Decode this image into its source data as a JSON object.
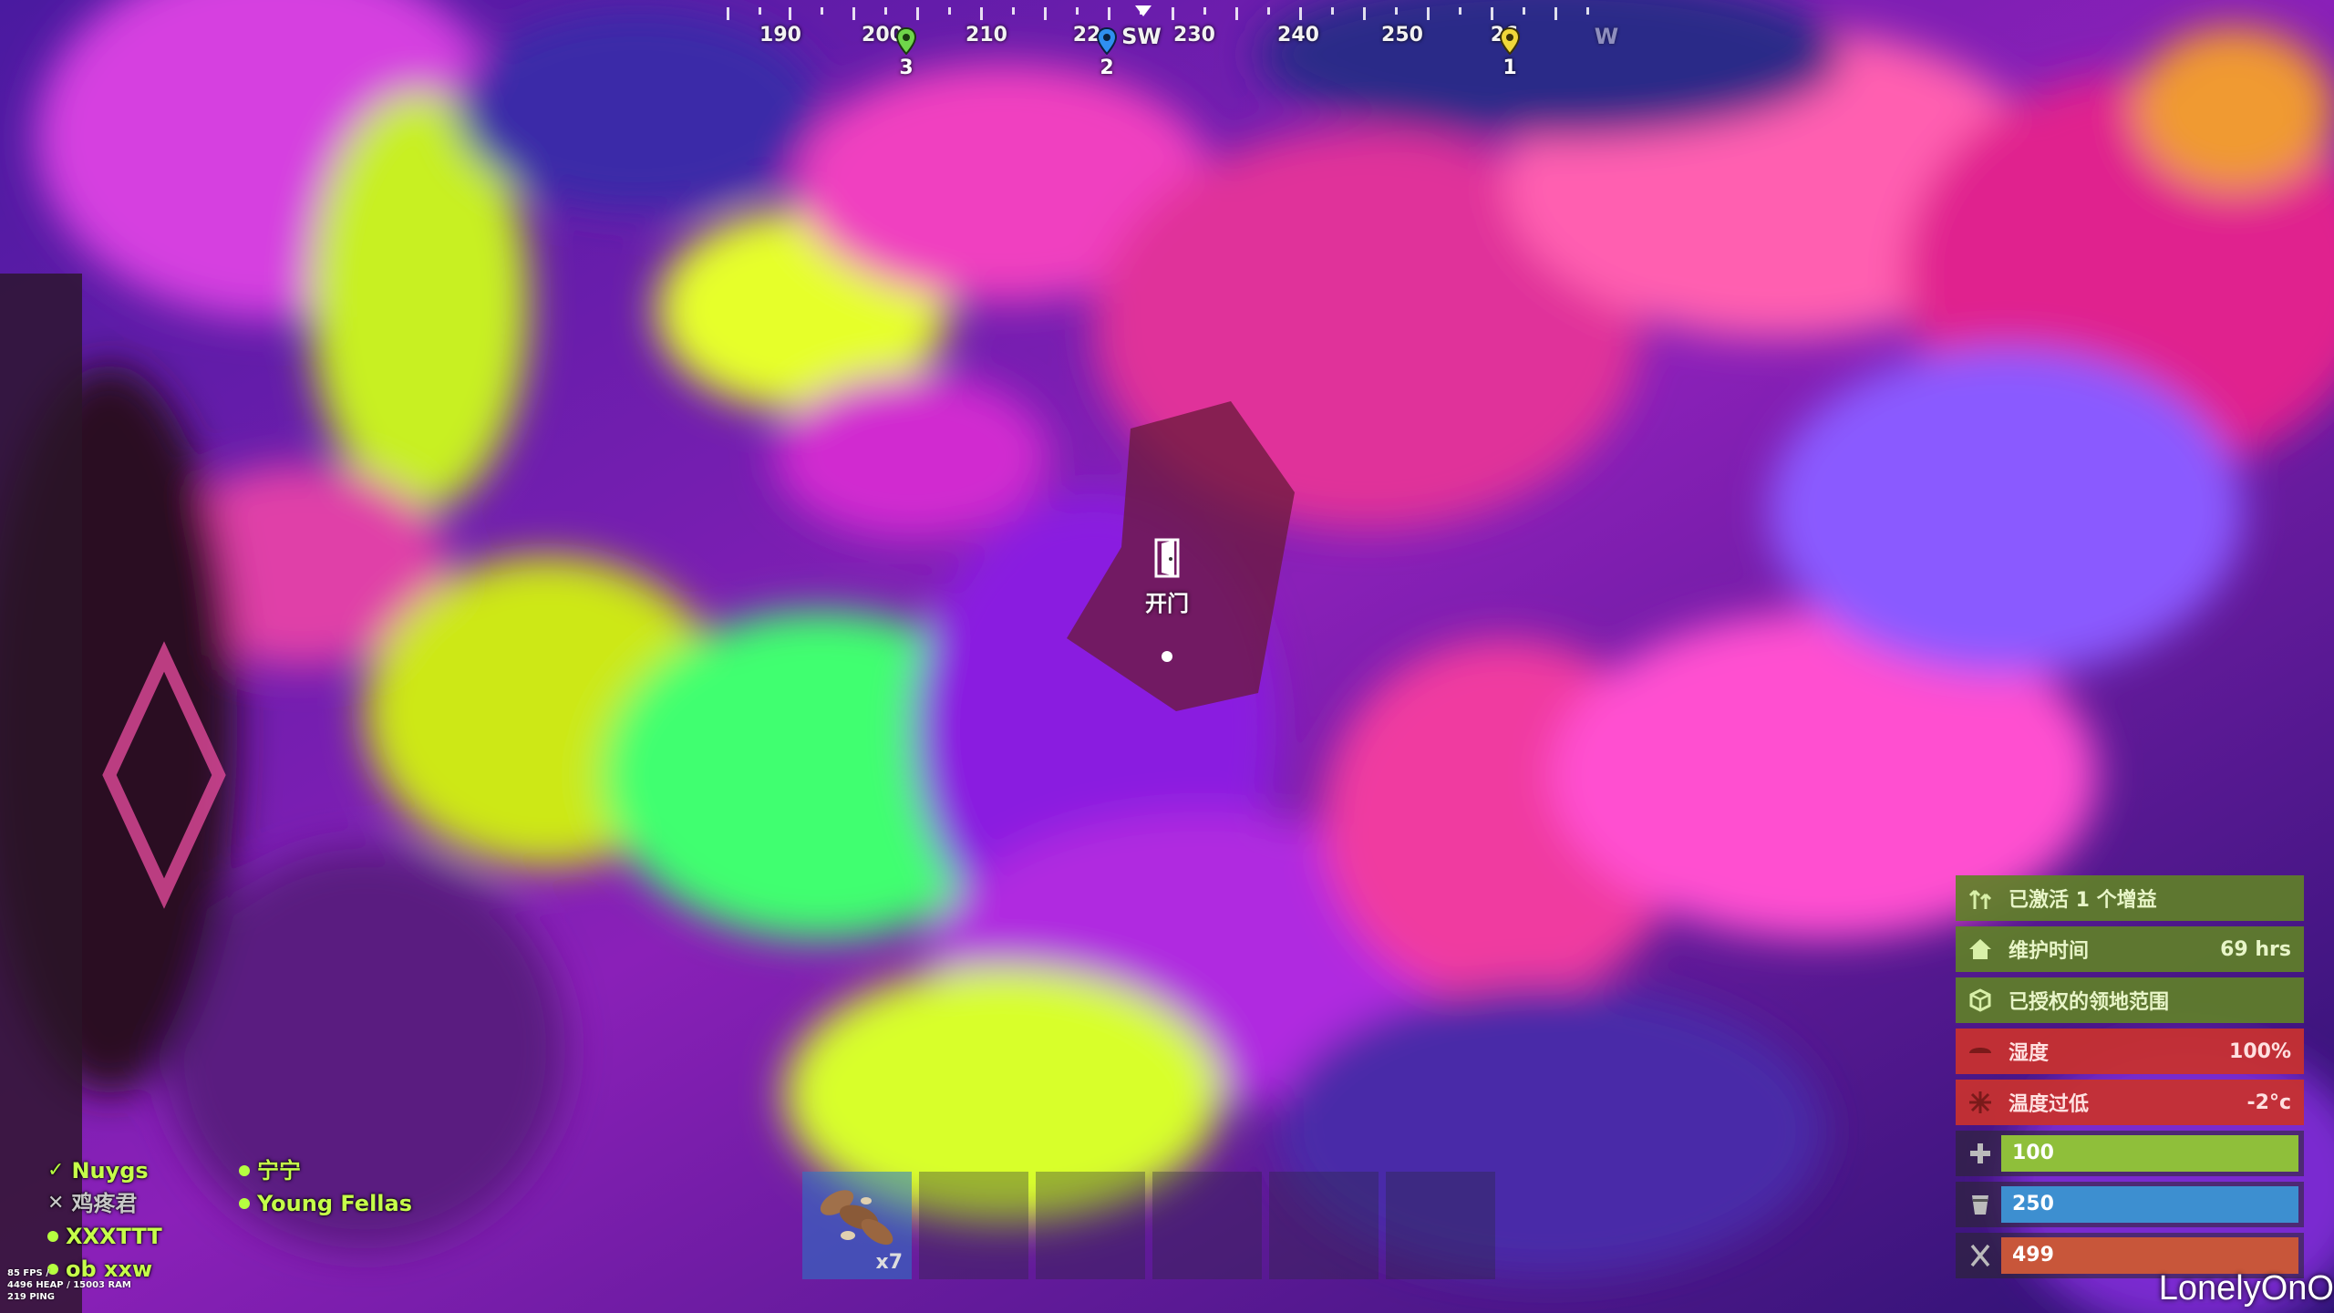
{
  "compass": {
    "labels": [
      "190",
      "200",
      "210",
      "22",
      "SW",
      "230",
      "240",
      "250",
      "26",
      "W"
    ],
    "markers": [
      {
        "number": "3",
        "color": "#6fd64a"
      },
      {
        "number": "2",
        "color": "#2f8ff0"
      },
      {
        "number": "1",
        "color": "#f0d83a"
      }
    ]
  },
  "interaction": {
    "label": "开门",
    "icon": "door-icon"
  },
  "team": {
    "column1": [
      {
        "name": "Nuygs",
        "state": "check"
      },
      {
        "name": "鸡疼君",
        "state": "cross"
      },
      {
        "name": "XXXTTT",
        "state": "dot"
      },
      {
        "name": "ob xxw",
        "state": "dot"
      }
    ],
    "column2": [
      {
        "name": "宁宁",
        "state": "dot"
      },
      {
        "name": "Young Fellas",
        "state": "dot"
      }
    ]
  },
  "perf": {
    "line1": "85 FPS / ",
    "line2": "4496 HEAP / 15003 RAM",
    "line3": "219 PING"
  },
  "hotbar": {
    "slot1_qty": "x7",
    "slot1_icon": "mushroom-icon"
  },
  "status": {
    "boost": {
      "text": "已激活 1 个增益"
    },
    "upkeep": {
      "text": "维护时间",
      "value": "69 hrs"
    },
    "building": {
      "text": "已授权的领地范围"
    },
    "wetness": {
      "text": "湿度",
      "value": "100%"
    },
    "cold": {
      "text": "温度过低",
      "value": "-2°c"
    }
  },
  "vitals": {
    "health": {
      "value": "100",
      "fraction": 1.0,
      "color": "#8fbf3a"
    },
    "hydration": {
      "value": "250",
      "fraction": 1.0,
      "color": "#3d8fd0"
    },
    "calories": {
      "value": "499",
      "fraction": 1.0,
      "color": "#c8563a"
    }
  },
  "watermark": "LonelyOnO"
}
